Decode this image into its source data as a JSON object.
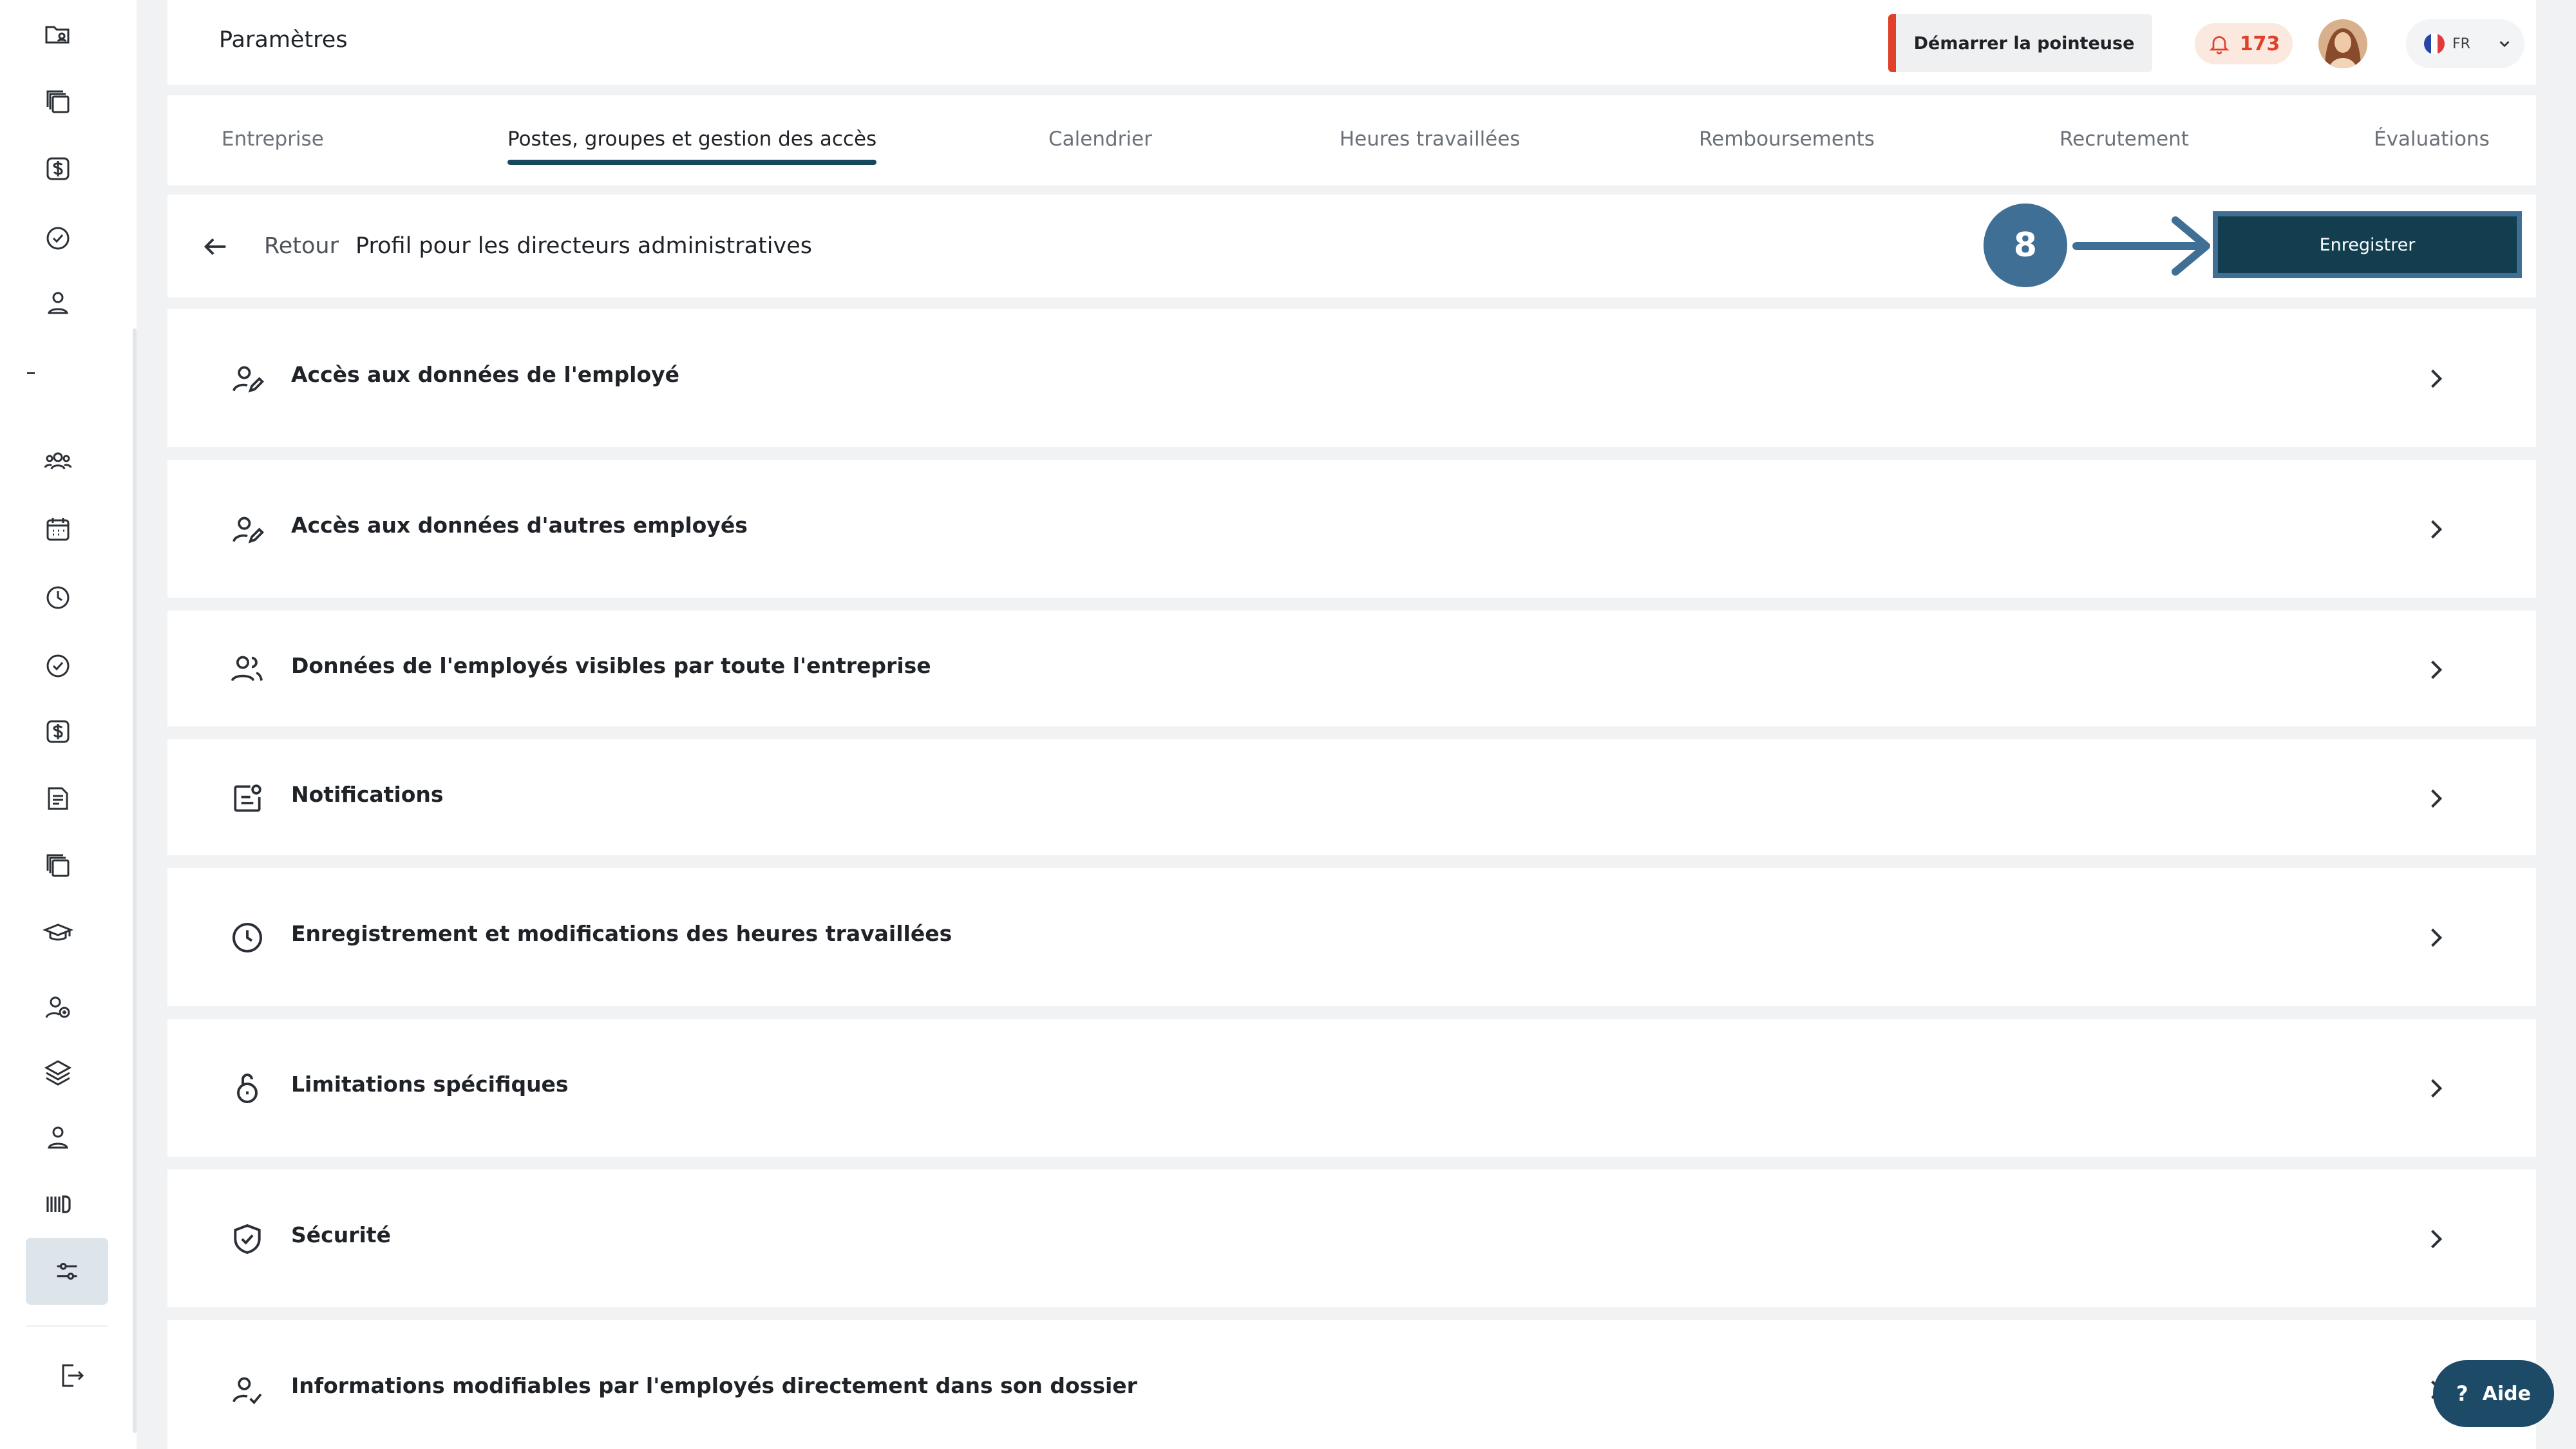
{
  "header": {
    "title": "Paramètres",
    "clock_button": "Démarrer la pointeuse",
    "notification_count": "173",
    "language": "FR"
  },
  "tabs": [
    {
      "label": "Entreprise",
      "active": false
    },
    {
      "label": "Postes, groupes et gestion des accès",
      "active": true
    },
    {
      "label": "Calendrier",
      "active": false
    },
    {
      "label": "Heures travaillées",
      "active": false
    },
    {
      "label": "Remboursements",
      "active": false
    },
    {
      "label": "Recrutement",
      "active": false
    },
    {
      "label": "Évaluations",
      "active": false
    }
  ],
  "subheader": {
    "back_label": "Retour",
    "profile_title": "Profil pour les directeurs administratives",
    "step_number": "8",
    "save_button": "Enregistrer"
  },
  "sections": [
    {
      "label": "Accès aux données de l'employé",
      "icon": "user-edit-icon"
    },
    {
      "label": "Accès aux données d'autres employés",
      "icon": "user-edit-icon"
    },
    {
      "label": "Données de l'employés visibles par toute l'entreprise",
      "icon": "users-icon"
    },
    {
      "label": "Notifications",
      "icon": "notification-card-icon"
    },
    {
      "label": "Enregistrement et modifications des heures travaillées",
      "icon": "clock-icon"
    },
    {
      "label": "Limitations spécifiques",
      "icon": "lock-icon"
    },
    {
      "label": "Sécurité",
      "icon": "shield-check-icon"
    },
    {
      "label": "Informations modifiables par l'employés directement dans son dossier",
      "icon": "user-check-icon"
    }
  ],
  "help": {
    "label": "Aide"
  },
  "colors": {
    "primary_dark": "#133e4f",
    "accent_blue": "#3f6f95",
    "alert_red": "#e0412a",
    "active_bg": "#dde4ea"
  }
}
